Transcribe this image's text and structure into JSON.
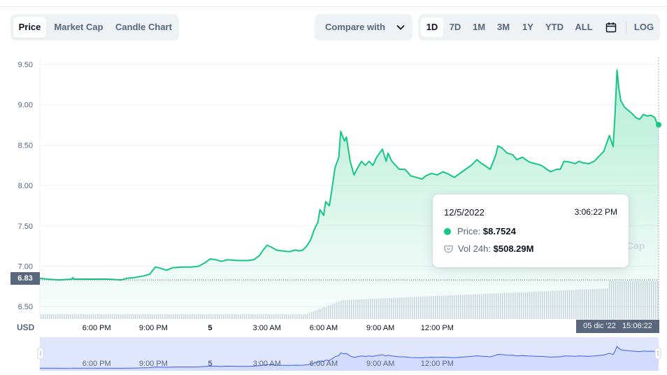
{
  "tabs": [
    {
      "label": "Price",
      "active": true
    },
    {
      "label": "Market Cap",
      "active": false
    },
    {
      "label": "Candle Chart",
      "active": false
    }
  ],
  "compare": {
    "label": "Compare with",
    "icon": "chevron-down-icon"
  },
  "ranges": [
    {
      "label": "1D",
      "active": true
    },
    {
      "label": "7D",
      "active": false
    },
    {
      "label": "1M",
      "active": false
    },
    {
      "label": "3M",
      "active": false
    },
    {
      "label": "1Y",
      "active": false
    },
    {
      "label": "YTD",
      "active": false
    },
    {
      "label": "ALL",
      "active": false
    }
  ],
  "calendar_icon": "calendar-icon",
  "log_label": "LOG",
  "watermark": "Cap",
  "tooltip": {
    "date": "12/5/2022",
    "time": "3:06:22 PM",
    "price_label": "Price:",
    "price_value": "$8.7524",
    "vol_label": "Vol 24h:",
    "vol_value": "$508.29M"
  },
  "currency_label": "USD",
  "current_price_label": "6.83",
  "current_date_label": "05 dic '22   15:06:22",
  "colors": {
    "line": "#16c784",
    "area": "#16c784",
    "volume": "#cfd6e4",
    "brush_line": "#3861fb",
    "brush_fill": "#dfe6fd",
    "label_bg": "#58667e"
  },
  "chart_data": {
    "type": "area",
    "ylabel": "USD",
    "ylim": [
      6.3,
      9.6
    ],
    "y_ticks": [
      "9.50",
      "9.00",
      "8.50",
      "8.00",
      "7.50",
      "7.00",
      "6.50"
    ],
    "x_ticks": [
      "6:00 PM",
      "9:00 PM",
      "5",
      "3:00 AM",
      "6:00 AM",
      "9:00 AM",
      "12:00 PM"
    ],
    "x_unit": "hours since 12/4/2022 3:00 PM",
    "series": [
      {
        "points": [
          [
            0,
            6.85
          ],
          [
            0.4,
            6.84
          ],
          [
            1,
            6.83
          ],
          [
            1.7,
            6.84
          ],
          [
            1.75,
            6.86
          ],
          [
            1.8,
            6.84
          ],
          [
            2.5,
            6.84
          ],
          [
            3,
            6.84
          ],
          [
            3.6,
            6.84
          ],
          [
            4.3,
            6.83
          ],
          [
            4.6,
            6.85
          ],
          [
            5,
            6.86
          ],
          [
            5.5,
            6.88
          ],
          [
            5.8,
            6.9
          ],
          [
            6.1,
            6.99
          ],
          [
            6.3,
            6.98
          ],
          [
            6.7,
            6.95
          ],
          [
            7,
            6.98
          ],
          [
            7.5,
            6.99
          ],
          [
            8,
            6.99
          ],
          [
            8.4,
            7.0
          ],
          [
            8.7,
            7.04
          ],
          [
            9,
            7.09
          ],
          [
            9.3,
            7.08
          ],
          [
            9.6,
            7.06
          ],
          [
            9.9,
            7.08
          ],
          [
            10.5,
            7.07
          ],
          [
            11,
            7.07
          ],
          [
            11.3,
            7.08
          ],
          [
            11.6,
            7.13
          ],
          [
            11.8,
            7.2
          ],
          [
            12,
            7.26
          ],
          [
            12.2,
            7.24
          ],
          [
            12.5,
            7.2
          ],
          [
            12.8,
            7.19
          ],
          [
            13.2,
            7.18
          ],
          [
            13.5,
            7.2
          ],
          [
            13.7,
            7.19
          ],
          [
            13.9,
            7.2
          ],
          [
            14.1,
            7.25
          ],
          [
            14.3,
            7.32
          ],
          [
            14.5,
            7.45
          ],
          [
            14.7,
            7.55
          ],
          [
            14.8,
            7.7
          ],
          [
            15,
            7.63
          ],
          [
            15.1,
            7.8
          ],
          [
            15.3,
            7.75
          ],
          [
            15.4,
            7.9
          ],
          [
            15.6,
            8.22
          ],
          [
            15.8,
            8.35
          ],
          [
            15.9,
            8.67
          ],
          [
            16.1,
            8.55
          ],
          [
            16.2,
            8.6
          ],
          [
            16.4,
            8.3
          ],
          [
            16.6,
            8.13
          ],
          [
            16.8,
            8.22
          ],
          [
            17,
            8.3
          ],
          [
            17.2,
            8.25
          ],
          [
            17.4,
            8.3
          ],
          [
            17.6,
            8.25
          ],
          [
            17.8,
            8.35
          ],
          [
            18.1,
            8.45
          ],
          [
            18.3,
            8.3
          ],
          [
            18.4,
            8.4
          ],
          [
            18.6,
            8.3
          ],
          [
            18.8,
            8.25
          ],
          [
            19,
            8.2
          ],
          [
            19.3,
            8.2
          ],
          [
            19.6,
            8.12
          ],
          [
            19.9,
            8.1
          ],
          [
            20.2,
            8.08
          ],
          [
            20.4,
            8.12
          ],
          [
            20.7,
            8.15
          ],
          [
            21,
            8.13
          ],
          [
            21.3,
            8.17
          ],
          [
            21.6,
            8.14
          ],
          [
            21.9,
            8.1
          ],
          [
            22.2,
            8.15
          ],
          [
            22.5,
            8.2
          ],
          [
            22.8,
            8.25
          ],
          [
            23.1,
            8.32
          ],
          [
            23.3,
            8.28
          ],
          [
            23.5,
            8.25
          ],
          [
            23.8,
            8.2
          ],
          [
            24.1,
            8.38
          ],
          [
            24.2,
            8.49
          ],
          [
            24.4,
            8.47
          ],
          [
            24.7,
            8.4
          ],
          [
            25,
            8.38
          ],
          [
            25.2,
            8.32
          ],
          [
            25.5,
            8.35
          ],
          [
            25.8,
            8.3
          ],
          [
            26,
            8.28
          ],
          [
            26.2,
            8.27
          ],
          [
            26.5,
            8.25
          ],
          [
            26.8,
            8.2
          ],
          [
            27,
            8.17
          ],
          [
            27.3,
            8.2
          ],
          [
            27.5,
            8.2
          ],
          [
            27.7,
            8.3
          ],
          [
            28,
            8.29
          ],
          [
            28.3,
            8.27
          ],
          [
            28.5,
            8.3
          ],
          [
            28.7,
            8.28
          ],
          [
            29,
            8.27
          ],
          [
            29.3,
            8.3
          ],
          [
            29.5,
            8.35
          ],
          [
            29.8,
            8.42
          ],
          [
            30.1,
            8.62
          ],
          [
            30.3,
            8.48
          ],
          [
            30.4,
            8.9
          ],
          [
            30.5,
            9.43
          ],
          [
            30.6,
            9.2
          ],
          [
            30.7,
            9.05
          ],
          [
            30.9,
            8.97
          ],
          [
            31.1,
            8.93
          ],
          [
            31.3,
            8.89
          ],
          [
            31.5,
            8.84
          ],
          [
            31.7,
            8.82
          ],
          [
            31.9,
            8.88
          ],
          [
            32.1,
            8.86
          ],
          [
            32.3,
            8.87
          ],
          [
            32.5,
            8.84
          ],
          [
            32.6,
            8.78
          ],
          [
            32.7,
            8.76
          ]
        ]
      }
    ],
    "current_value": 8.7524,
    "gridlines": true
  }
}
